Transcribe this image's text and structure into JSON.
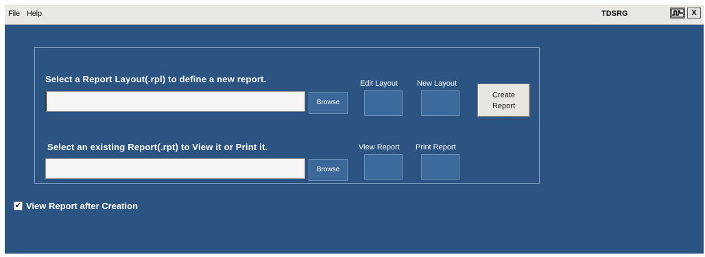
{
  "menu": {
    "file": "File",
    "help": "Help",
    "app_title": "TDSRG",
    "window_close": "X",
    "waveform_icon": "waveform-icon"
  },
  "layout_section": {
    "prompt": "Select a Report Layout(.rpl) to define a new report.",
    "input_value": "",
    "browse_label": "Browse",
    "edit_layout_label": "Edit Layout",
    "new_layout_label": "New Layout"
  },
  "report_section": {
    "prompt": "Select an existing  Report(.rpt) to View it or Print it.",
    "input_value": "",
    "browse_label": "Browse",
    "view_report_label": "View Report",
    "print_report_label": "Print Report"
  },
  "create_report": {
    "line1": "Create",
    "line2": "Report"
  },
  "options": {
    "view_after_creation_label": "View Report after Creation",
    "view_after_creation_checked": true
  },
  "colors": {
    "background": "#2c5483",
    "menubar": "#eae8e4",
    "button": "#3d6a9c"
  }
}
